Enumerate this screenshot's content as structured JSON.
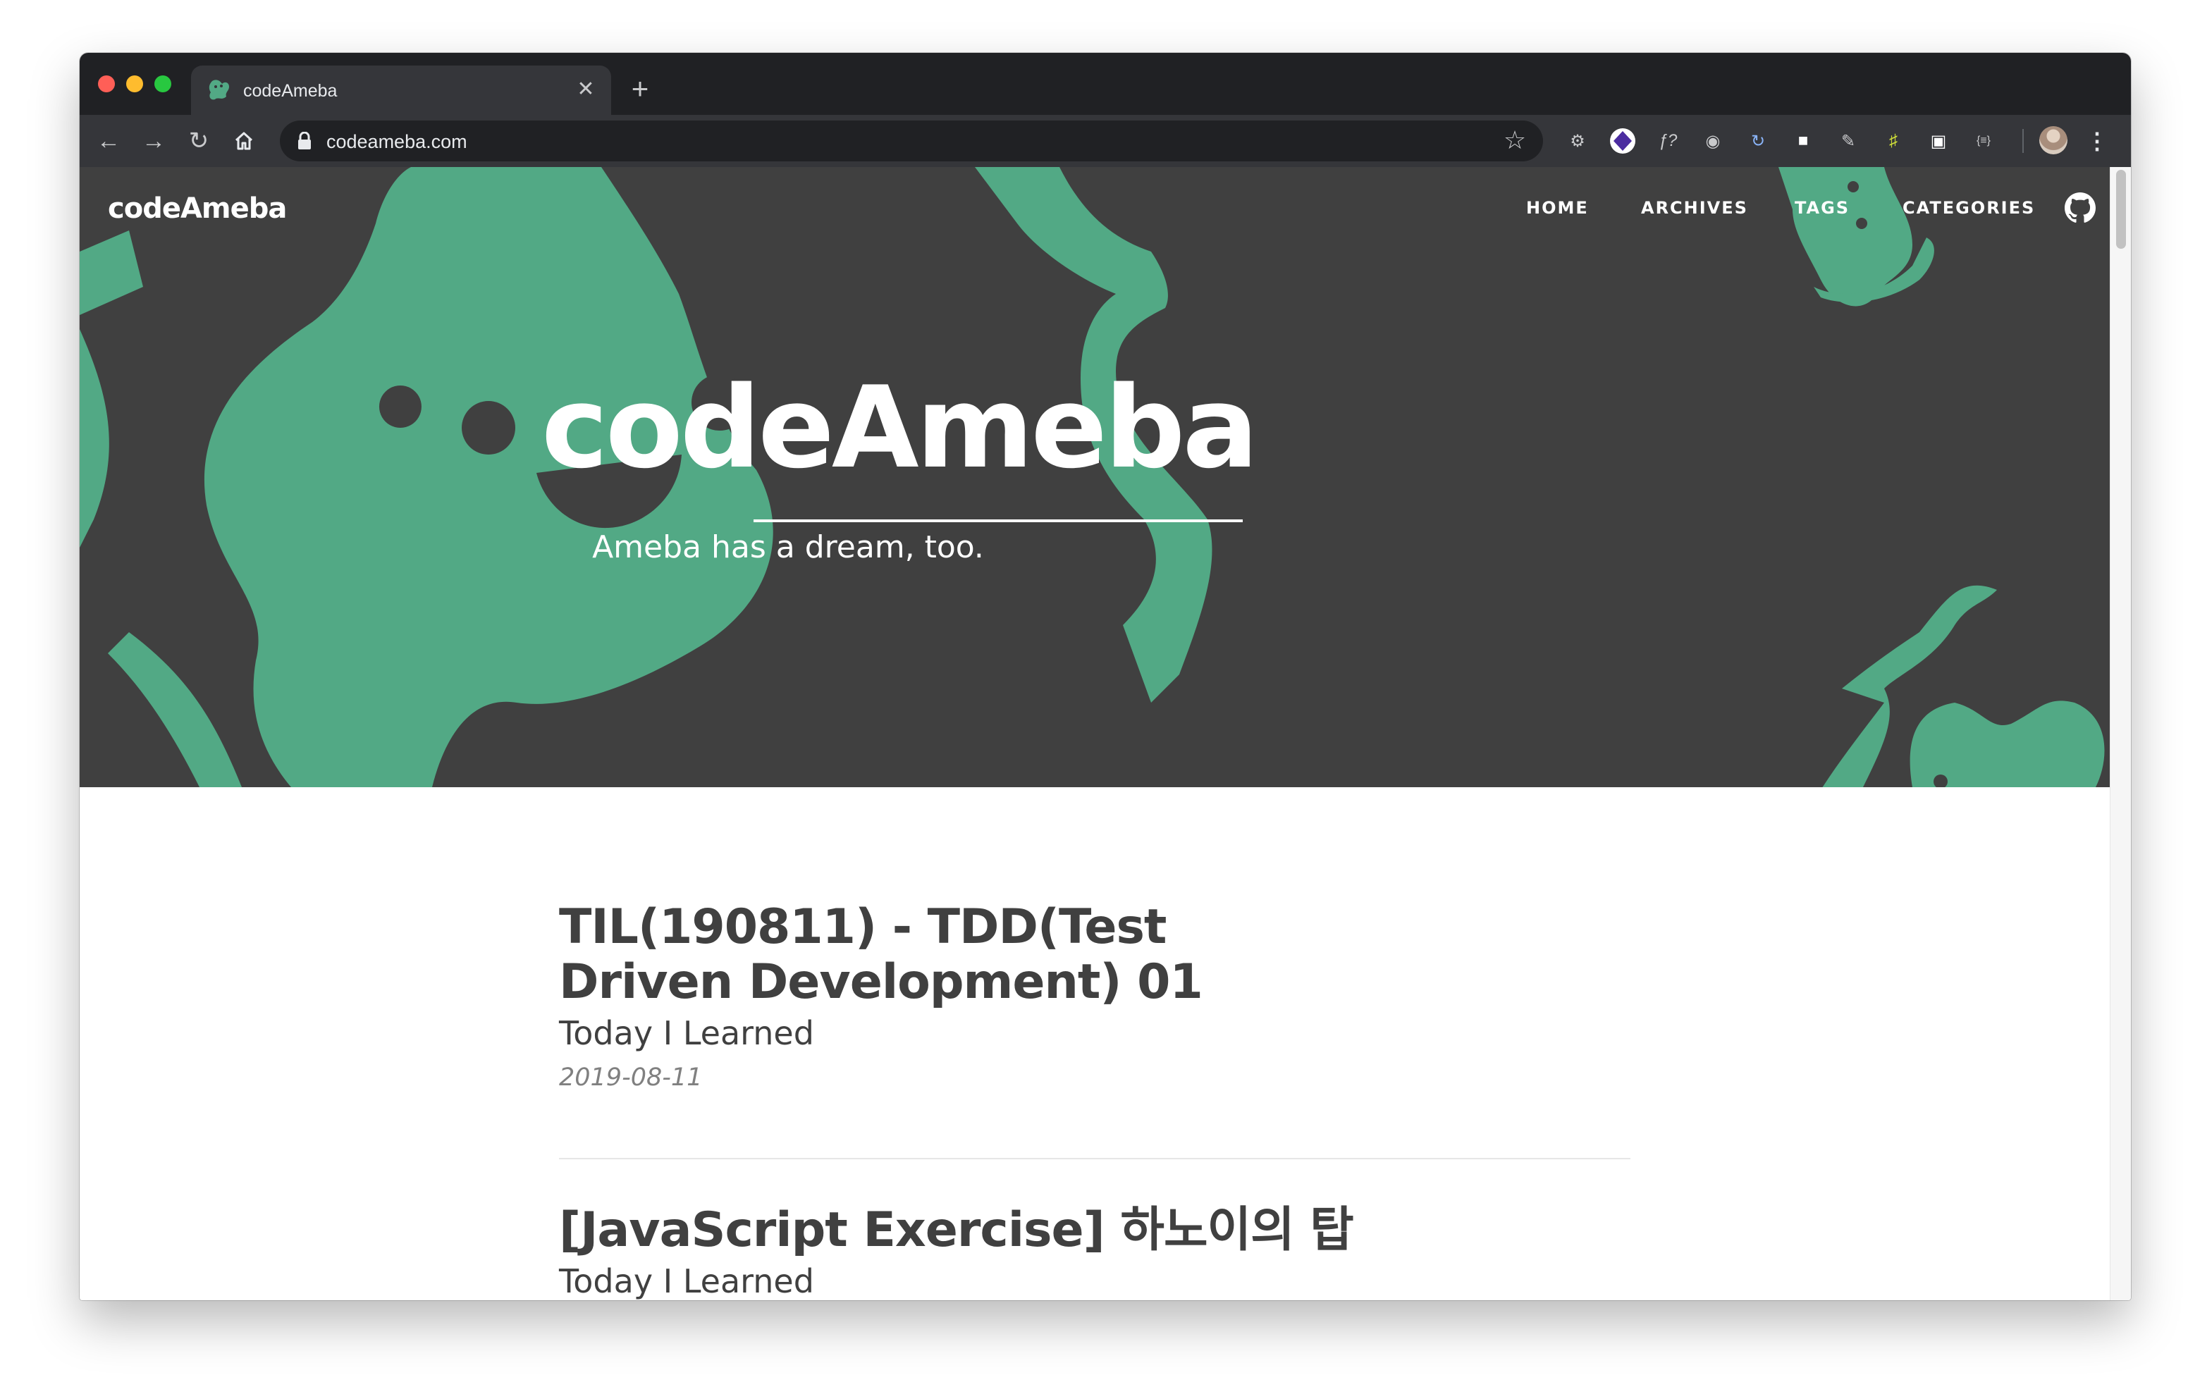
{
  "browser": {
    "tab": {
      "title": "codeAmeba",
      "close_glyph": "✕",
      "favicon": "ameba-favicon-icon"
    },
    "new_tab_glyph": "+",
    "nav": {
      "back": "←",
      "forward": "→",
      "reload": "↻",
      "home": "home-icon"
    },
    "address_bar": {
      "url": "codeameba.com",
      "lock": "lock-icon",
      "bookmark_glyph": "☆"
    },
    "extensions": [
      {
        "name": "settings-gear-extension-icon",
        "glyph": "⚙"
      },
      {
        "name": "purple-diamond-extension-icon",
        "glyph": ""
      },
      {
        "name": "function-extension-icon",
        "glyph": "ƒ?"
      },
      {
        "name": "eye-extension-icon",
        "glyph": "◉"
      },
      {
        "name": "rotate-extension-icon",
        "glyph": "↻"
      },
      {
        "name": "square-extension-icon",
        "glyph": "■"
      },
      {
        "name": "pen-extension-icon",
        "glyph": "✎"
      },
      {
        "name": "ladder-extension-icon",
        "glyph": "♯"
      },
      {
        "name": "window-extension-icon",
        "glyph": "▣"
      },
      {
        "name": "code-braces-extension-icon",
        "glyph": "{≡}"
      }
    ],
    "menu_glyph": "⋮"
  },
  "site": {
    "brand": "codeAmeba",
    "nav": [
      "HOME",
      "ARCHIVES",
      "TAGS",
      "CATEGORIES"
    ],
    "hero": {
      "title": "codeAmeba",
      "subtitle": "Ameba has a dream, too."
    },
    "colors": {
      "hero_bg": "#404040",
      "ameba_green": "#52a985",
      "text": "#404040",
      "meta": "#808080"
    }
  },
  "posts": [
    {
      "title": "TIL(190811) - TDD(Test Driven Development) 01",
      "subtitle": "Today I Learned",
      "date": "2019-08-11"
    },
    {
      "title": "[JavaScript Exercise] 하노이의 탑",
      "subtitle": "Today I Learned"
    }
  ]
}
